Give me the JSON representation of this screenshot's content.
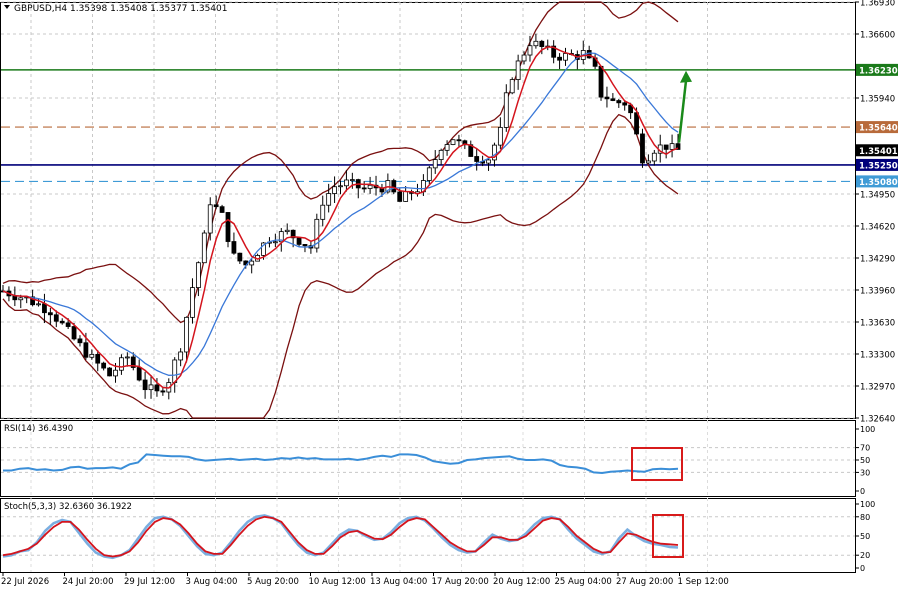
{
  "colors": {
    "candle": "#000000",
    "bollinger": "#7a1010",
    "fast_ma": "#d4141d",
    "slow_ma": "#3a78d8",
    "resistance": "#1a7a1a",
    "support": "#00007a",
    "pivot": "#b86a3a",
    "lower_level": "#3f9bd6",
    "indicator_line": "#3a8ed8",
    "stoch_signal": "#d4141d",
    "highlight_box": "#d81b1b",
    "arrow": "#1a8a1a"
  },
  "chart_data": [
    {
      "type": "candlestick",
      "title": "GBPUSD,H4  1.35398 1.35408 1.35377 1.35401",
      "symbol": "GBPUSD",
      "timeframe": "H4",
      "ohlc_label": "1.35398 1.35408 1.35377 1.35401",
      "ylim": [
        1.3264,
        1.3693
      ],
      "y_ticks": [
        "1.36930",
        "1.36600",
        "1.36230",
        "1.35940",
        "1.35640",
        "1.35401",
        "1.35250",
        "1.35080",
        "1.34950",
        "1.34620",
        "1.34290",
        "1.33960",
        "1.33630",
        "1.33300",
        "1.32970",
        "1.32640"
      ],
      "x_labels": [
        "22 Jul 2026",
        "24 Jul 20:00",
        "29 Jul 12:00",
        "3 Aug 04:00",
        "5 Aug 20:00",
        "10 Aug 12:00",
        "13 Aug 04:00",
        "17 Aug 20:00",
        "20 Aug 12:00",
        "25 Aug 04:00",
        "27 Aug 20:00",
        "1 Sep 12:00"
      ],
      "horizontal_levels": [
        {
          "value": 1.3623,
          "label": "1.36230",
          "style": "solid",
          "color": "#1a7a1a"
        },
        {
          "value": 1.3564,
          "label": "1.35640",
          "style": "dashed",
          "color": "#b86a3a"
        },
        {
          "value": 1.35401,
          "label": "1.35401",
          "style": "price",
          "color": "#000000"
        },
        {
          "value": 1.3525,
          "label": "1.35250",
          "style": "solid",
          "color": "#00007a"
        },
        {
          "value": 1.3508,
          "label": "1.35080",
          "style": "dashed",
          "color": "#3f9bd6"
        }
      ],
      "close_path": [
        [
          0,
          1.3395
        ],
        [
          4,
          1.3387
        ],
        [
          8,
          1.3375
        ],
        [
          12,
          1.3345
        ],
        [
          15,
          1.3325
        ],
        [
          18,
          1.3308
        ],
        [
          21,
          1.3327
        ],
        [
          24,
          1.3296
        ],
        [
          26,
          1.3289
        ],
        [
          28,
          1.3304
        ],
        [
          30,
          1.3338
        ],
        [
          32,
          1.3399
        ],
        [
          34,
          1.345
        ],
        [
          35,
          1.3488
        ],
        [
          37,
          1.3472
        ],
        [
          39,
          1.343
        ],
        [
          41,
          1.3422
        ],
        [
          43,
          1.3436
        ],
        [
          45,
          1.345
        ],
        [
          48,
          1.3455
        ],
        [
          50,
          1.3448
        ],
        [
          52,
          1.344
        ],
        [
          54,
          1.3488
        ],
        [
          56,
          1.3503
        ],
        [
          58,
          1.3506
        ],
        [
          61,
          1.35
        ],
        [
          63,
          1.3502
        ],
        [
          65,
          1.3503
        ],
        [
          67,
          1.3487
        ],
        [
          69,
          1.3497
        ],
        [
          71,
          1.3504
        ],
        [
          72,
          1.3518
        ],
        [
          74,
          1.3545
        ],
        [
          76,
          1.3553
        ],
        [
          78,
          1.3541
        ],
        [
          80,
          1.3533
        ],
        [
          82,
          1.3532
        ],
        [
          84,
          1.3559
        ],
        [
          85,
          1.3594
        ],
        [
          86,
          1.3618
        ],
        [
          88,
          1.3641
        ],
        [
          89,
          1.3652
        ],
        [
          91,
          1.3646
        ],
        [
          93,
          1.3638
        ],
        [
          95,
          1.3637
        ],
        [
          97,
          1.3638
        ],
        [
          98,
          1.364
        ],
        [
          100,
          1.3622
        ],
        [
          101,
          1.3598
        ],
        [
          102,
          1.3595
        ],
        [
          103,
          1.359
        ],
        [
          105,
          1.3589
        ],
        [
          106,
          1.3578
        ],
        [
          107,
          1.3555
        ],
        [
          108,
          1.3533
        ],
        [
          109,
          1.3535
        ],
        [
          110,
          1.3542
        ],
        [
          112,
          1.3545
        ],
        [
          113,
          1.3541
        ],
        [
          114,
          1.35401
        ]
      ],
      "series": [
        {
          "name": "Candles",
          "kind": "candles"
        },
        {
          "kind": "bollinger",
          "period": 20,
          "deviation": 2
        },
        {
          "kind": "ma",
          "period": 5
        },
        {
          "kind": "ma",
          "period": 13
        }
      ],
      "annotations": [
        "up arrow toward 1.36230"
      ]
    },
    {
      "type": "line",
      "title": "RSI(14) 36.4390",
      "indicator": "RSI",
      "params": "14",
      "value_label": "36.4390",
      "ylim": [
        0,
        100
      ],
      "y_ticks": [
        "100",
        "70",
        "50",
        "30",
        "0"
      ],
      "levels": [
        70,
        50,
        30
      ],
      "values": [
        33,
        33,
        36,
        37,
        34,
        35,
        33,
        34,
        38,
        39,
        36,
        37,
        37,
        38,
        36,
        43,
        46,
        59,
        58,
        57,
        56,
        56,
        55,
        51,
        49,
        50,
        51,
        52,
        50,
        51,
        52,
        50,
        51,
        53,
        52,
        54,
        52,
        53,
        51,
        51,
        51,
        52,
        50,
        52,
        55,
        57,
        55,
        59,
        59,
        58,
        54,
        48,
        46,
        44,
        45,
        50,
        51,
        53,
        54,
        55,
        56,
        52,
        50,
        50,
        51,
        49,
        42,
        39,
        38,
        36,
        30,
        29,
        31,
        32,
        33,
        32,
        31,
        35,
        36,
        35,
        36
      ]
    },
    {
      "type": "line",
      "title": "Stoch(5,3,3) 32.6360 36.1922",
      "indicator": "Stochastic",
      "params": "5,3,3",
      "value_label": "32.6360 36.1922",
      "ylim": [
        0,
        100
      ],
      "y_ticks": [
        "100",
        "80",
        "50",
        "20",
        "0"
      ],
      "levels": [
        80,
        50,
        20
      ],
      "main": [
        18,
        20,
        26,
        28,
        40,
        58,
        70,
        75,
        72,
        55,
        38,
        24,
        18,
        16,
        20,
        28,
        46,
        64,
        78,
        80,
        76,
        66,
        50,
        34,
        22,
        20,
        24,
        40,
        58,
        72,
        80,
        82,
        78,
        70,
        52,
        36,
        24,
        20,
        24,
        38,
        52,
        60,
        58,
        50,
        44,
        46,
        56,
        70,
        78,
        80,
        74,
        62,
        48,
        36,
        28,
        24,
        26,
        40,
        52,
        46,
        42,
        44,
        54,
        68,
        78,
        80,
        76,
        60,
        46,
        36,
        26,
        22,
        26,
        46,
        60,
        50,
        42,
        38,
        36,
        33,
        32
      ],
      "signal": [
        20,
        22,
        26,
        30,
        38,
        52,
        64,
        72,
        72,
        60,
        44,
        30,
        20,
        18,
        20,
        26,
        40,
        58,
        72,
        78,
        76,
        68,
        54,
        38,
        26,
        22,
        22,
        36,
        52,
        66,
        76,
        80,
        78,
        72,
        56,
        40,
        28,
        22,
        22,
        34,
        48,
        56,
        58,
        52,
        46,
        45,
        52,
        64,
        74,
        78,
        76,
        64,
        52,
        40,
        32,
        26,
        26,
        36,
        48,
        48,
        44,
        44,
        50,
        62,
        74,
        78,
        76,
        64,
        50,
        40,
        30,
        24,
        25,
        40,
        54,
        52,
        46,
        41,
        38,
        37,
        36
      ]
    }
  ]
}
